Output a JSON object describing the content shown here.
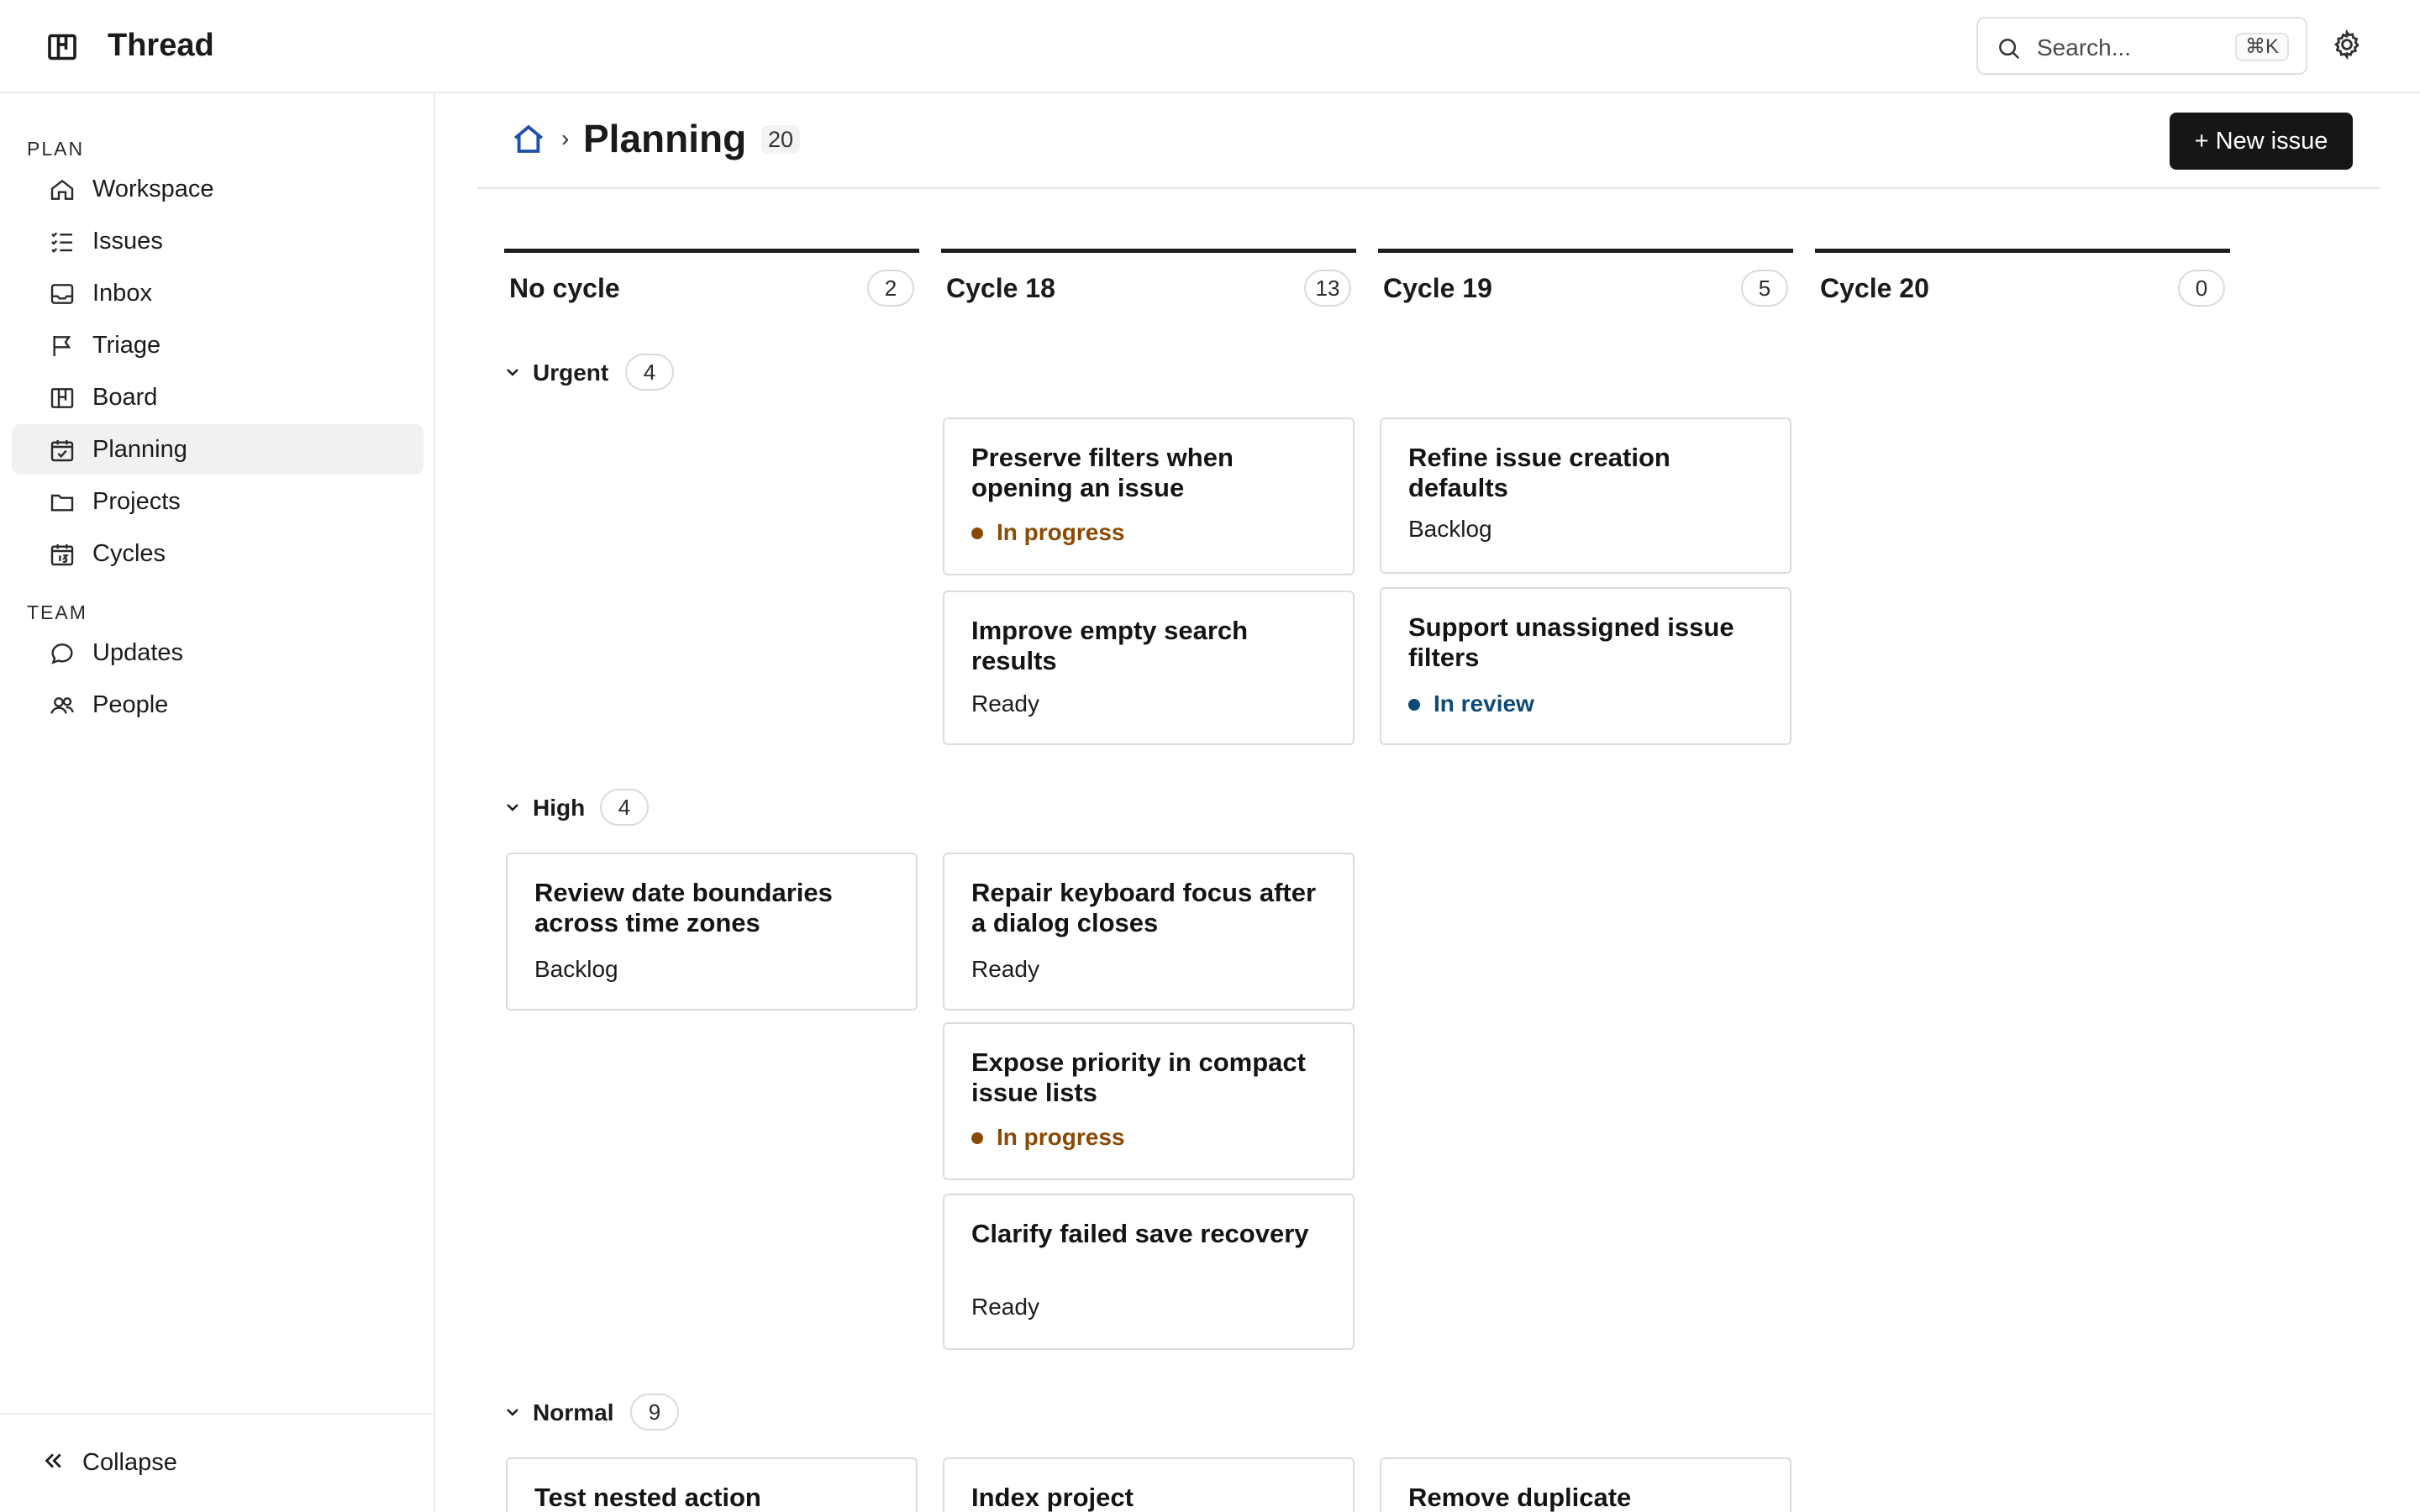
{
  "app": {
    "title": "Thread"
  },
  "search": {
    "placeholder": "Search...",
    "shortcut": "⌘K"
  },
  "sidebar": {
    "sections": [
      {
        "label": "PLAN"
      },
      {
        "label": "TEAM"
      }
    ],
    "items": [
      {
        "label": "Workspace",
        "icon": "home-icon"
      },
      {
        "label": "Issues",
        "icon": "checklist-icon"
      },
      {
        "label": "Inbox",
        "icon": "inbox-icon"
      },
      {
        "label": "Triage",
        "icon": "flag-icon"
      },
      {
        "label": "Board",
        "icon": "board-icon"
      },
      {
        "label": "Planning",
        "icon": "calendar-check-icon",
        "active": true
      },
      {
        "label": "Projects",
        "icon": "folder-icon"
      },
      {
        "label": "Cycles",
        "icon": "calendar-icon"
      },
      {
        "label": "Updates",
        "icon": "chat-bubble-icon"
      },
      {
        "label": "People",
        "icon": "people-icon"
      }
    ],
    "collapse_label": "Collapse"
  },
  "header": {
    "title": "Planning",
    "count": "20",
    "breadcrumb_separator": "›",
    "new_issue_label": "+ New issue"
  },
  "columns": [
    {
      "title": "No cycle",
      "count": "2"
    },
    {
      "title": "Cycle 18",
      "count": "13"
    },
    {
      "title": "Cycle 19",
      "count": "5"
    },
    {
      "title": "Cycle 20",
      "count": "0"
    }
  ],
  "groups": [
    {
      "label": "Urgent",
      "count": "4",
      "cards": [
        {
          "column": 1,
          "title": "Preserve filters when opening an issue",
          "status": "In progress",
          "status_type": "progress"
        },
        {
          "column": 1,
          "title": "Improve empty search results",
          "status": "Ready",
          "status_type": "plain"
        },
        {
          "column": 2,
          "title": "Refine issue creation defaults",
          "status": "Backlog",
          "status_type": "plain"
        },
        {
          "column": 2,
          "title": "Support unassigned issue filters",
          "status": "In review",
          "status_type": "review"
        }
      ]
    },
    {
      "label": "High",
      "count": "4",
      "cards": [
        {
          "column": 0,
          "title": "Review date boundaries across time zones",
          "status": "Backlog",
          "status_type": "plain"
        },
        {
          "column": 1,
          "title": "Repair keyboard focus after a dialog closes",
          "status": "Ready",
          "status_type": "plain"
        },
        {
          "column": 1,
          "title": "Expose priority in compact issue lists",
          "status": "In progress",
          "status_type": "progress"
        },
        {
          "column": 1,
          "title": "Clarify failed save recovery",
          "status": "Ready",
          "status_type": "plain"
        }
      ]
    },
    {
      "label": "Normal",
      "count": "9",
      "cards": [
        {
          "column": 0,
          "title": "Test nested action",
          "status": "",
          "status_type": "plain"
        },
        {
          "column": 1,
          "title": "Index project",
          "status": "",
          "status_type": "plain"
        },
        {
          "column": 2,
          "title": "Remove duplicate",
          "status": "",
          "status_type": "plain"
        }
      ]
    }
  ],
  "colors": {
    "in_progress": "#8a4a05",
    "in_review": "#0c4a78",
    "primary_button": "#161616",
    "active_nav_bg": "#f1f1f1"
  }
}
